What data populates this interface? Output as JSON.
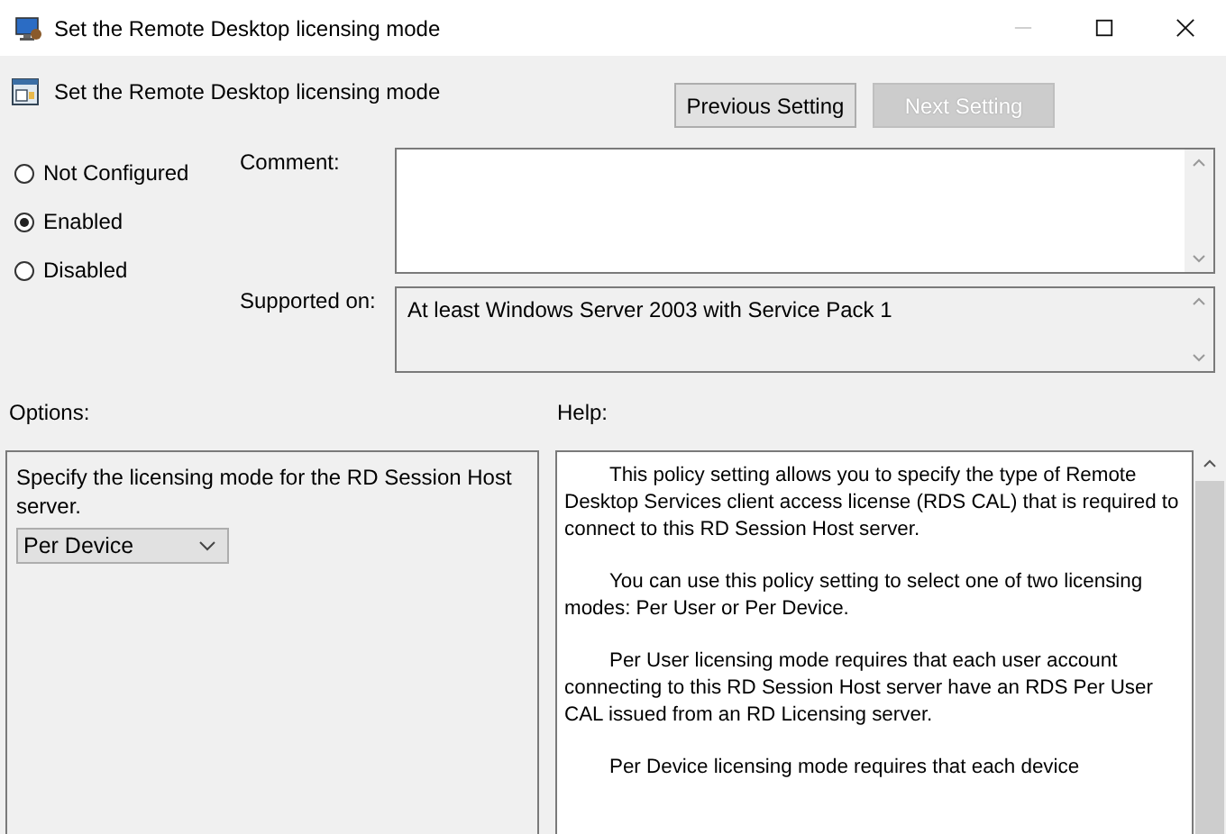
{
  "window": {
    "title": "Set the Remote Desktop licensing mode"
  },
  "header": {
    "title": "Set the Remote Desktop licensing mode",
    "buttons": [
      {
        "label": "Previous Setting",
        "disabled": false
      },
      {
        "label": "Next Setting",
        "disabled": true
      }
    ]
  },
  "state_options": [
    {
      "label": "Not Configured",
      "selected": false
    },
    {
      "label": "Enabled",
      "selected": true
    },
    {
      "label": "Disabled",
      "selected": false
    }
  ],
  "comment": {
    "label": "Comment:"
  },
  "supported_on": {
    "label": "Supported on:",
    "value": "At least Windows Server 2003 with Service Pack 1"
  },
  "options": {
    "label": "Options:",
    "description": "Specify the licensing mode for the RD Session Host server.",
    "dropdown": {
      "value": "Per Device"
    }
  },
  "help": {
    "label": "Help:",
    "paragraphs": [
      "This policy setting allows you to specify the type of Remote Desktop Services client access license (RDS CAL) that is required to connect to this RD Session Host server.",
      "You can use this policy setting to select one of two licensing modes: Per User or Per Device.",
      "Per User licensing mode requires that each user account connecting to this RD Session Host server have an RDS Per User CAL issued from an RD Licensing server.",
      "Per Device licensing mode requires that each device"
    ]
  }
}
